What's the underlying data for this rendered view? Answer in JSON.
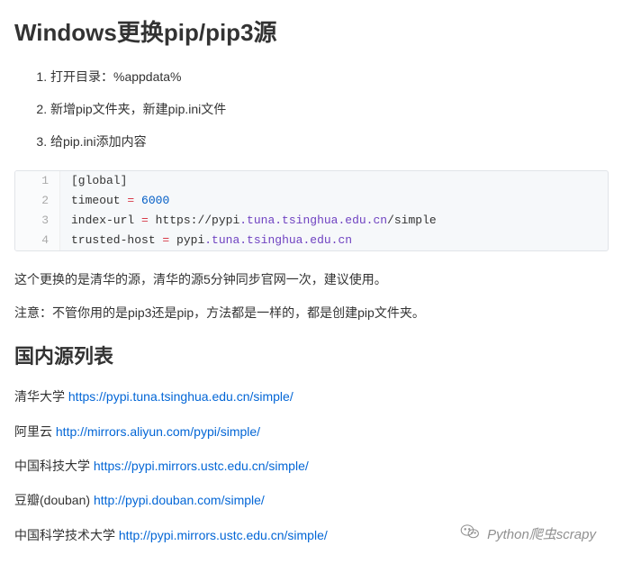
{
  "heading1": "Windows更换pip/pip3源",
  "steps": [
    "打开目录：%appdata%",
    "新增pip文件夹，新建pip.ini文件",
    "给pip.ini添加内容"
  ],
  "code": {
    "l1": "[global]",
    "l2a": "timeout ",
    "l2op": "=",
    "l2b": " ",
    "l2num": "6000",
    "l3a": "index-url ",
    "l3op": "=",
    "l3b": " https:",
    "l3c": "//pypi",
    "l3dom": ".tuna.tsinghua.edu.cn",
    "l3d": "/simple",
    "l4a": "trusted-host ",
    "l4op": "=",
    "l4b": " pypi",
    "l4dom": ".tuna.tsinghua.edu.cn"
  },
  "para1": "这个更换的是清华的源，清华的源5分钟同步官网一次，建议使用。",
  "para2": "注意：不管你用的是pip3还是pip，方法都是一样的，都是创建pip文件夹。",
  "heading2": "国内源列表",
  "mirrors": [
    {
      "name": "清华大学",
      "url": "https://pypi.tuna.tsinghua.edu.cn/simple/"
    },
    {
      "name": "阿里云",
      "url": "http://mirrors.aliyun.com/pypi/simple/"
    },
    {
      "name": "中国科技大学",
      "url": "https://pypi.mirrors.ustc.edu.cn/simple/"
    },
    {
      "name": "豆瓣(douban)",
      "url": "http://pypi.douban.com/simple/"
    },
    {
      "name": "中国科学技术大学",
      "url": "http://pypi.mirrors.ustc.edu.cn/simple/"
    }
  ],
  "watermark": "Python爬虫scrapy",
  "lineNumbers": {
    "n1": "1",
    "n2": "2",
    "n3": "3",
    "n4": "4"
  }
}
